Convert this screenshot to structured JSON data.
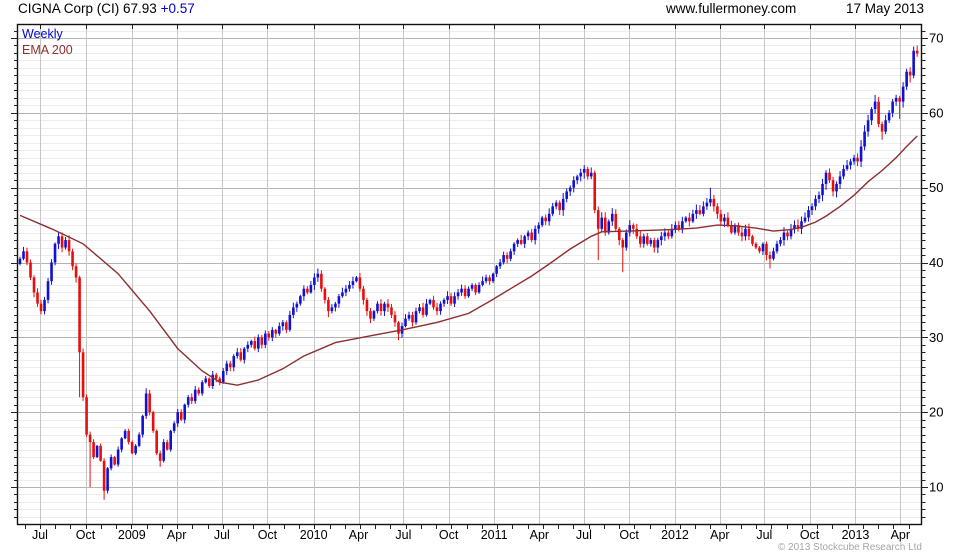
{
  "header": {
    "title_main": "CIGNA Corp (CI) 67.93",
    "title_change": "+0.57",
    "site": "www.fullermoney.com",
    "date": "17 May 2013"
  },
  "legend": {
    "weekly": "Weekly",
    "ema": "EMA 200"
  },
  "footer": {
    "copyright": "© 2013 Stockcube Research Ltd"
  },
  "colors": {
    "up_candle": "#1111d0",
    "down_candle": "#e80e0e",
    "ema_line": "#8b2f2f",
    "grid_minor": "#ededed",
    "grid_major_h": "#b3b3b3",
    "grid_vertical": "#c6c6c6",
    "border": "#111111",
    "axis_text": "#000000",
    "change_text": "#0000cc"
  },
  "chart_data": {
    "type": "candlestick",
    "instrument": "CIGNA Corp (CI)",
    "timeframe": "Weekly",
    "last_price": 67.93,
    "change": 0.57,
    "overlay": "EMA 200",
    "grid": "on",
    "y_axis": {
      "side": "right",
      "ticks": [
        10,
        20,
        30,
        40,
        50,
        60,
        70
      ],
      "minor_step": 1,
      "top_value": 71.7,
      "bottom_value": 5.1
    },
    "x_axis": {
      "labels": [
        {
          "text": "Jul",
          "week": 5.7
        },
        {
          "text": "Oct",
          "week": 18.7
        },
        {
          "text": "2009",
          "week": 31.9
        },
        {
          "text": "Apr",
          "week": 44.7
        },
        {
          "text": "Jul",
          "week": 57.6
        },
        {
          "text": "Oct",
          "week": 70.6
        },
        {
          "text": "2010",
          "week": 83.8
        },
        {
          "text": "Apr",
          "week": 96.6
        },
        {
          "text": "Jul",
          "week": 109.4
        },
        {
          "text": "Oct",
          "week": 122.3
        },
        {
          "text": "2011",
          "week": 135.3
        },
        {
          "text": "Apr",
          "week": 148.2
        },
        {
          "text": "Jul",
          "week": 160.9
        },
        {
          "text": "Oct",
          "week": 173.8
        },
        {
          "text": "2012",
          "week": 186.9
        },
        {
          "text": "Apr",
          "week": 199.7
        },
        {
          "text": "Jul",
          "week": 212.4
        },
        {
          "text": "Oct",
          "week": 225.3
        },
        {
          "text": "2013",
          "week": 238.4
        },
        {
          "text": "Apr",
          "week": 251.2
        }
      ]
    },
    "weeks_total": 257,
    "series": [
      {
        "name": "Weekly",
        "type": "candles",
        "closes": [
          40.5,
          41.5,
          40,
          38,
          36,
          34.5,
          33.5,
          35,
          37.5,
          40,
          42.5,
          43.5,
          42,
          43,
          41.5,
          39.5,
          38,
          28,
          22,
          17,
          16,
          14,
          15.5,
          13.5,
          9.5,
          12.5,
          14,
          13,
          15,
          16.5,
          17.5,
          16,
          14.5,
          15.5,
          17,
          19.5,
          22.5,
          20,
          17.5,
          14.5,
          13.5,
          16,
          15,
          17.5,
          18.5,
          20,
          19,
          21,
          22,
          21.5,
          23,
          22.5,
          24,
          24.5,
          23.5,
          25,
          24.5,
          24,
          25.5,
          26.5,
          26,
          27.5,
          28,
          27,
          28.5,
          29,
          29.5,
          28.5,
          30,
          29,
          30.5,
          30,
          31,
          30.5,
          31.5,
          32,
          31,
          33,
          34,
          34.5,
          35.5,
          36.5,
          36,
          37,
          38,
          38.5,
          36.5,
          35,
          33.5,
          34,
          34.5,
          35.5,
          36,
          36.5,
          37,
          37.5,
          38,
          36.5,
          35,
          33.5,
          32.5,
          33.5,
          34.5,
          33.5,
          34.5,
          34,
          33,
          32,
          30.5,
          31.5,
          32.5,
          33,
          32,
          33.5,
          34,
          33,
          34.5,
          35,
          34,
          33.5,
          34.5,
          35,
          35.5,
          34.5,
          35.5,
          36,
          36.5,
          35.5,
          36.5,
          37,
          36,
          37,
          37.5,
          38,
          37.5,
          38.5,
          39.5,
          40,
          41,
          40.5,
          41.5,
          42.5,
          43,
          42.5,
          43.5,
          44,
          43,
          44.5,
          45,
          46,
          45.5,
          46.5,
          47.5,
          48,
          47,
          48.5,
          49.5,
          50,
          51,
          51.5,
          52,
          52.5,
          51.5,
          52,
          47,
          44.5,
          46,
          44,
          45.5,
          46.5,
          44.5,
          43,
          42,
          44,
          45,
          44.5,
          43.5,
          42.5,
          43.5,
          42.5,
          43,
          42,
          43,
          43.5,
          44,
          43.5,
          44.5,
          45,
          44.5,
          45.5,
          46,
          45.5,
          46.5,
          47,
          46.5,
          47.5,
          48,
          48.5,
          47.5,
          46.5,
          45.5,
          46,
          45,
          44,
          45,
          44,
          43.5,
          44.5,
          43.5,
          42.5,
          42,
          41.5,
          42.5,
          41,
          40.5,
          41.5,
          42.5,
          43,
          44,
          43.5,
          44.5,
          45,
          44.5,
          45.5,
          46,
          47,
          47.5,
          48.5,
          49,
          50.5,
          52,
          51,
          49.5,
          50.5,
          51.5,
          52.5,
          53,
          53.5,
          54,
          53.5,
          55.5,
          57.5,
          59,
          60.5,
          61.5,
          58.5,
          57.5,
          59,
          60,
          61.5,
          62,
          61.5,
          63.5,
          65.5,
          65,
          68.3,
          67.93
        ],
        "low_wick_overrides": {
          "17": 22.0,
          "20": 10.0,
          "24": 8.3,
          "40": 12.7,
          "88": 32.7,
          "100": 31.9,
          "108": 29.6,
          "165": 40.3,
          "172": 38.7,
          "214": 39.2,
          "246": 56.4,
          "251": 59.2
        },
        "high_wick_overrides": {
          "36": 23.2,
          "85": 39.2,
          "96": 38.2,
          "161": 53.0,
          "197": 50.0,
          "244": 62.4,
          "256": 69.0
        }
      },
      {
        "name": "EMA 200",
        "type": "line",
        "points": [
          [
            0,
            46.3
          ],
          [
            9,
            44.5
          ],
          [
            18,
            42.5
          ],
          [
            28,
            38.5
          ],
          [
            37,
            33.5
          ],
          [
            45,
            28.5
          ],
          [
            52,
            25.5
          ],
          [
            57,
            24.0
          ],
          [
            62,
            23.6
          ],
          [
            68,
            24.3
          ],
          [
            75,
            25.8
          ],
          [
            81,
            27.5
          ],
          [
            90,
            29.3
          ],
          [
            100,
            30.2
          ],
          [
            109,
            31.0
          ],
          [
            119,
            32.0
          ],
          [
            128,
            33.2
          ],
          [
            134,
            34.8
          ],
          [
            140,
            36.5
          ],
          [
            146,
            38.2
          ],
          [
            151,
            39.8
          ],
          [
            157,
            41.8
          ],
          [
            163,
            43.5
          ],
          [
            166,
            44.1
          ],
          [
            173,
            44.2
          ],
          [
            180,
            44.3
          ],
          [
            186,
            44.4
          ],
          [
            193,
            44.6
          ],
          [
            199,
            45.0
          ],
          [
            204,
            44.9
          ],
          [
            210,
            44.6
          ],
          [
            215,
            44.2
          ],
          [
            220,
            44.4
          ],
          [
            223,
            44.7
          ],
          [
            227,
            45.4
          ],
          [
            230,
            46.2
          ],
          [
            234,
            47.5
          ],
          [
            238,
            49.0
          ],
          [
            242,
            50.8
          ],
          [
            246,
            52.3
          ],
          [
            250,
            54.0
          ],
          [
            253,
            55.5
          ],
          [
            256,
            56.9
          ]
        ]
      }
    ]
  }
}
